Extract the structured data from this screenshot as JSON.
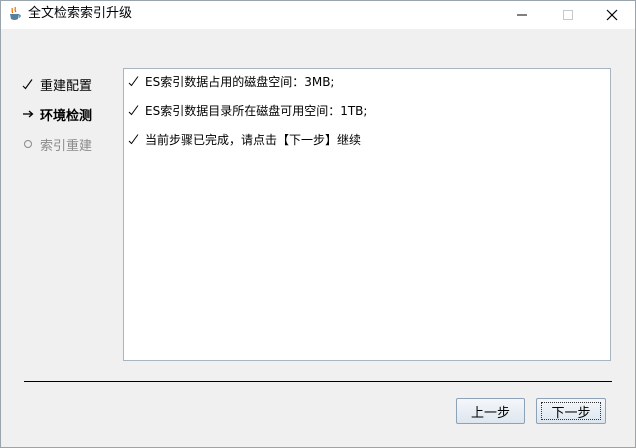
{
  "window": {
    "title": "全文检索索引升级",
    "icon": "java-cup-icon",
    "controls": {
      "minimize": "minimize-icon",
      "maximize": "maximize-icon",
      "close": "close-icon"
    }
  },
  "steps": [
    {
      "label": "重建配置",
      "state": "done",
      "icon": "check-icon"
    },
    {
      "label": "环境检测",
      "state": "current",
      "icon": "arrow-right-icon"
    },
    {
      "label": "索引重建",
      "state": "pending",
      "icon": "circle-icon"
    }
  ],
  "log": {
    "lines": [
      "ES索引数据占用的磁盘空间：3MB;",
      "ES索引数据目录所在磁盘可用空间：1TB;",
      "当前步骤已完成，请点击【下一步】继续"
    ]
  },
  "buttons": {
    "prev_label": "上一步",
    "next_label": "下一步"
  },
  "colors": {
    "window_bg": "#f0f0f0",
    "panel_border": "#a9b5c0",
    "pending_text": "#8a8a8a",
    "button_border": "#8da2b8"
  }
}
